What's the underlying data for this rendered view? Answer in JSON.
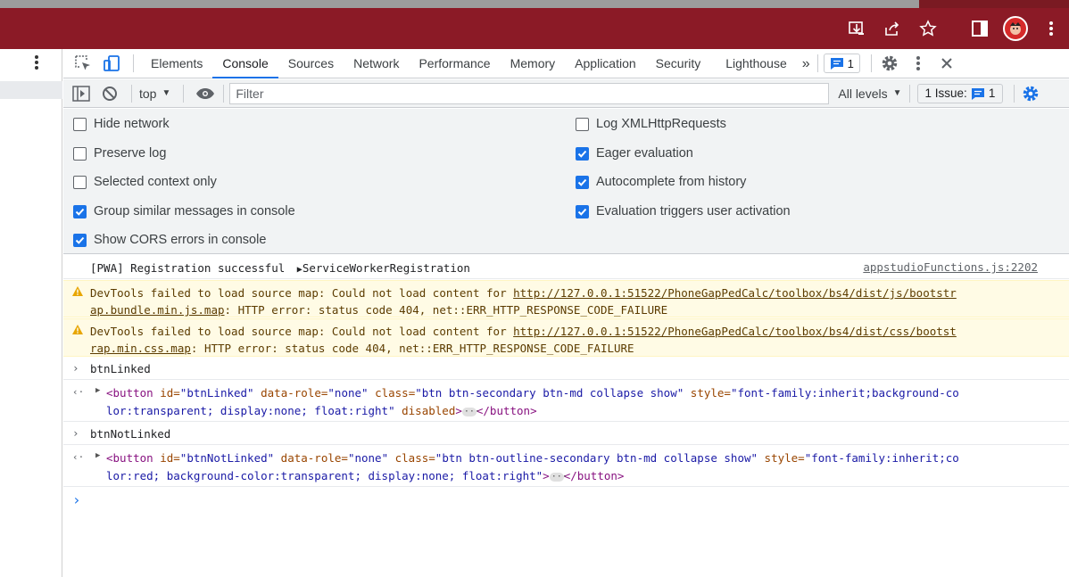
{
  "browser": {
    "colors": {
      "bar": "#8b1a26",
      "strip": "#9c9c9c"
    },
    "icons": [
      "install-icon",
      "share-icon",
      "star-icon",
      "sidepanel-icon",
      "profile-avatar",
      "browser-menu-icon"
    ]
  },
  "devtools": {
    "tabs": [
      {
        "label": "Elements"
      },
      {
        "label": "Console"
      },
      {
        "label": "Sources"
      },
      {
        "label": "Network"
      },
      {
        "label": "Performance"
      },
      {
        "label": "Memory"
      },
      {
        "label": "Application"
      },
      {
        "label": "Security"
      },
      {
        "label": "Lighthouse"
      }
    ],
    "more_tabs": "»",
    "issues_badge_count": "1",
    "toolbar": {
      "context": "top",
      "filter_placeholder": "Filter",
      "levels": "All levels",
      "issues_label": "1 Issue:",
      "issues_count": "1"
    },
    "settings": {
      "left": [
        {
          "label": "Hide network",
          "checked": false
        },
        {
          "label": "Preserve log",
          "checked": false
        },
        {
          "label": "Selected context only",
          "checked": false
        },
        {
          "label": "Group similar messages in console",
          "checked": true
        },
        {
          "label": "Show CORS errors in console",
          "checked": true
        }
      ],
      "right": [
        {
          "label": "Log XMLHttpRequests",
          "checked": false
        },
        {
          "label": "Eager evaluation",
          "checked": true
        },
        {
          "label": "Autocomplete from history",
          "checked": true
        },
        {
          "label": "Evaluation triggers user activation",
          "checked": true
        }
      ]
    },
    "console": {
      "log1": {
        "text": "[PWA] Registration successful",
        "object": "ServiceWorkerRegistration",
        "source": "appstudioFunctions.js:2202"
      },
      "warn1": {
        "prefix": "DevTools failed to load source map: Could not load content for ",
        "url_line1": "http://127.0.0.1:51522/PhoneGapPedCalc/toolbox/bs4/dist/js/bootstr",
        "url_line2": "ap.bundle.min.js.map",
        "suffix": ": HTTP error: status code 404, net::ERR_HTTP_RESPONSE_CODE_FAILURE"
      },
      "warn2": {
        "prefix": "DevTools failed to load source map: Could not load content for ",
        "url_line1": "http://127.0.0.1:51522/PhoneGapPedCalc/toolbox/bs4/dist/css/bootst",
        "url_line2": "rap.min.css.map",
        "suffix": ": HTTP error: status code 404, net::ERR_HTTP_RESPONSE_CODE_FAILURE"
      },
      "input1": "btnLinked",
      "result1": {
        "line1_tag": "<button ",
        "id_attr": "id=",
        "id_val": "\"btnLinked\"",
        "role_attr": " data-role=",
        "role_val": "\"none\"",
        "class_attr": " class=",
        "class_val": "\"btn btn-secondary btn-md collapse show\"",
        "style_attr": " style=",
        "style_val1": "\"font-family:inherit;background-co",
        "style_val2": "lor:transparent; display:none; float:right\"",
        "disabled_attr": " disabled",
        "close_open": ">",
        "close_tag": "</button>"
      },
      "input2": "btnNotLinked",
      "result2": {
        "line1_tag": "<button ",
        "id_attr": "id=",
        "id_val": "\"btnNotLinked\"",
        "role_attr": " data-role=",
        "role_val": "\"none\"",
        "class_attr": " class=",
        "class_val": "\"btn btn-outline-secondary btn-md collapse show\"",
        "style_attr": " style=",
        "style_val1": "\"font-family:inherit;co",
        "style_val2": "lor:red; background-color:transparent; display:none; float:right\"",
        "close_open": ">",
        "close_tag": "</button>"
      }
    }
  }
}
